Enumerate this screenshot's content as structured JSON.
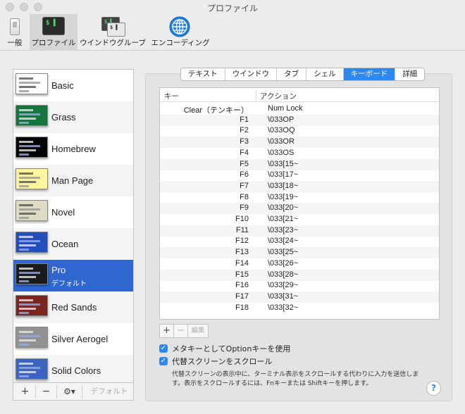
{
  "window": {
    "title": "プロファイル"
  },
  "toolbar": {
    "items": [
      {
        "label": "一般"
      },
      {
        "label": "プロファイル"
      },
      {
        "label": "ウインドウグループ"
      },
      {
        "label": "エンコーディング"
      }
    ]
  },
  "profiles": [
    {
      "name": "Basic",
      "bg": "#ffffff"
    },
    {
      "name": "Grass",
      "bg": "#13773d"
    },
    {
      "name": "Homebrew",
      "bg": "#000000"
    },
    {
      "name": "Man Page",
      "bg": "#fef49c"
    },
    {
      "name": "Novel",
      "bg": "#dfdbc3"
    },
    {
      "name": "Ocean",
      "bg": "#224fbc"
    },
    {
      "name": "Pro",
      "sub": "デフォルト",
      "bg": "#1a1a1a"
    },
    {
      "name": "Red Sands",
      "bg": "#7a251e"
    },
    {
      "name": "Silver Aerogel",
      "bg": "#929292"
    },
    {
      "name": "Solid Colors",
      "bg": "#3b64c0"
    }
  ],
  "sidebar_footer": {
    "add": "+",
    "remove": "−",
    "gear": "⚙▾",
    "default_label": "デフォルト"
  },
  "tabs": [
    "テキスト",
    "ウインドウ",
    "タブ",
    "シェル",
    "キーボード",
    "詳細"
  ],
  "keyboard_table": {
    "columns": {
      "key": "キー",
      "action": "アクション"
    },
    "rows": [
      {
        "key": "Clear（テンキー）",
        "action": "Num Lock"
      },
      {
        "key": "F1",
        "action": "\\033OP"
      },
      {
        "key": "F2",
        "action": "\\033OQ"
      },
      {
        "key": "F3",
        "action": "\\033OR"
      },
      {
        "key": "F4",
        "action": "\\033OS"
      },
      {
        "key": "F5",
        "action": "\\033[15~"
      },
      {
        "key": "F6",
        "action": "\\033[17~"
      },
      {
        "key": "F7",
        "action": "\\033[18~"
      },
      {
        "key": "F8",
        "action": "\\033[19~"
      },
      {
        "key": "F9",
        "action": "\\033[20~"
      },
      {
        "key": "F10",
        "action": "\\033[21~"
      },
      {
        "key": "F11",
        "action": "\\033[23~"
      },
      {
        "key": "F12",
        "action": "\\033[24~"
      },
      {
        "key": "F13",
        "action": "\\033[25~"
      },
      {
        "key": "F14",
        "action": "\\033[26~"
      },
      {
        "key": "F15",
        "action": "\\033[28~"
      },
      {
        "key": "F16",
        "action": "\\033[29~"
      },
      {
        "key": "F17",
        "action": "\\033[31~"
      },
      {
        "key": "F18",
        "action": "\\033[32~"
      }
    ],
    "buttons": {
      "add": "+",
      "remove": "−",
      "edit": "編集"
    }
  },
  "options": {
    "meta_key": "メタキーとしてOptionキーを使用",
    "alt_screen_scroll": "代替スクリーンをスクロール",
    "description": "代替スクリーンの表示中に、ターミナル表示をスクロールする代わりに入力を送信します。表示をスクロールするには、Fnキーまたは Shiftキーを押します。"
  },
  "help": "?"
}
